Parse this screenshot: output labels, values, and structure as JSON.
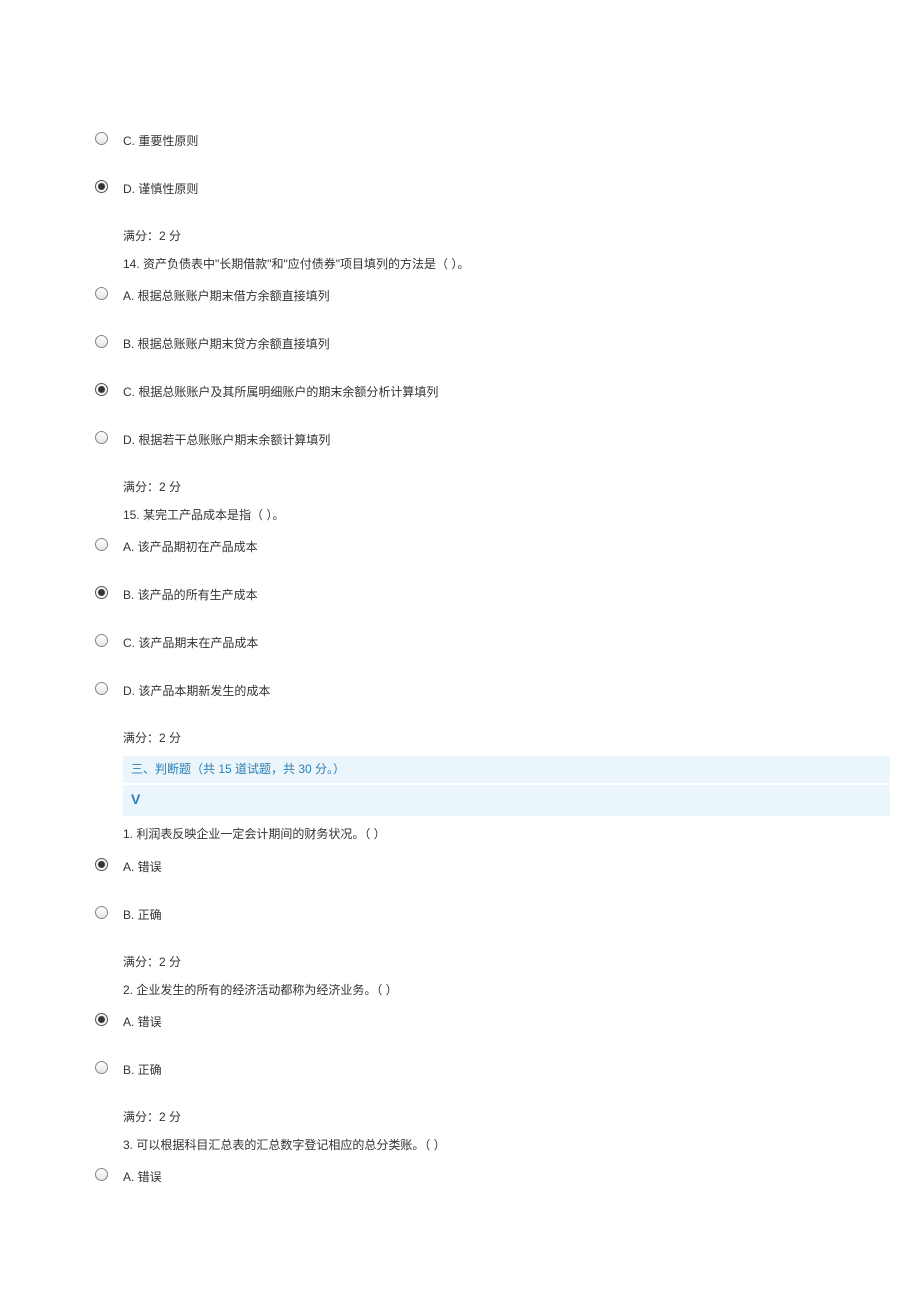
{
  "q13": {
    "optC": "C. 重要性原则",
    "optD": "D. 谨慎性原则",
    "score": "满分：2 分"
  },
  "q14": {
    "prompt": "14. 资产负债表中\"长期借款\"和\"应付债券\"项目填列的方法是（ ）。",
    "optA": "A. 根据总账账户期末借方余额直接填列",
    "optB": "B. 根据总账账户期末贷方余额直接填列",
    "optC": "C. 根据总账账户及其所属明细账户的期末余额分析计算填列",
    "optD": "D. 根据若干总账账户期末余额计算填列",
    "score": "满分：2 分"
  },
  "q15": {
    "prompt": "15. 某完工产品成本是指（ ）。",
    "optA": "A. 该产品期初在产品成本",
    "optB": "B. 该产品的所有生产成本",
    "optC": "C. 该产品期末在产品成本",
    "optD": "D. 该产品本期新发生的成本",
    "score": "满分：2 分"
  },
  "section3": {
    "title": "三、判断题（共 15 道试题，共 30 分。）",
    "sub": "V"
  },
  "j1": {
    "prompt": "1. 利润表反映企业一定会计期间的财务状况。（ ）",
    "optA": "A. 错误",
    "optB": "B. 正确",
    "score": "满分：2 分"
  },
  "j2": {
    "prompt": "2. 企业发生的所有的经济活动都称为经济业务。（ ）",
    "optA": "A. 错误",
    "optB": "B. 正确",
    "score": "满分：2 分"
  },
  "j3": {
    "prompt": "3. 可以根据科目汇总表的汇总数字登记相应的总分类账。（ ）",
    "optA": "A. 错误"
  }
}
